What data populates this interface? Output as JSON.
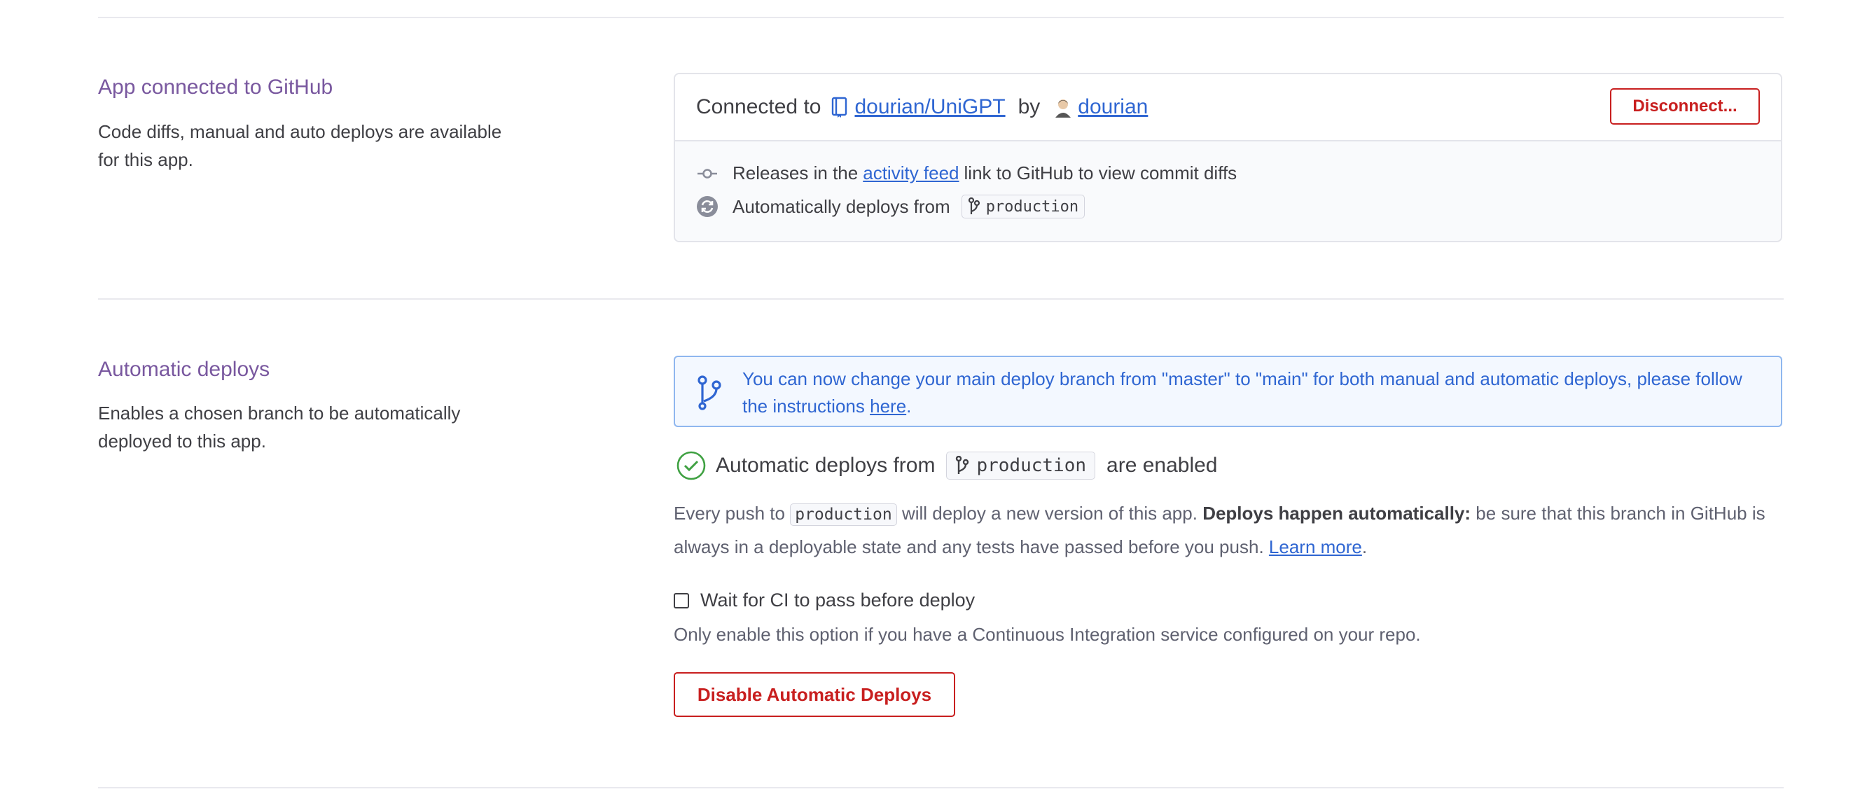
{
  "github_section": {
    "title": "App connected to GitHub",
    "description": "Code diffs, manual and auto deploys are available for this app.",
    "connected_prefix": "Connected to",
    "repo_link": "dourian/UniGPT",
    "by_label": "by",
    "user_link": "dourian",
    "disconnect_label": "Disconnect...",
    "releases_prefix": "Releases in the",
    "activity_feed_link": "activity feed",
    "releases_suffix": "link to GitHub to view commit diffs",
    "auto_deploys_prefix": "Automatically deploys from",
    "branch": "production"
  },
  "auto_deploys_section": {
    "title": "Automatic deploys",
    "description": "Enables a chosen branch to be automatically deployed to this app.",
    "banner_text": "You can now change your main deploy branch from \"master\" to \"main\" for both manual and automatic deploys, please follow the instructions",
    "banner_link": "here",
    "banner_end": ".",
    "enabled_prefix": "Automatic deploys from",
    "branch": "production",
    "enabled_suffix": "are enabled",
    "push_prefix": "Every push to",
    "push_branch": "production",
    "push_middle": "will deploy a new version of this app.",
    "push_bold": "Deploys happen automatically:",
    "push_rest": "be sure that this branch in GitHub is always in a deployable state and any tests have passed before you push.",
    "learn_more": "Learn more",
    "learn_more_end": ".",
    "ci_checkbox_label": "Wait for CI to pass before deploy",
    "ci_checked": false,
    "ci_hint": "Only enable this option if you have a Continuous Integration service configured on your repo.",
    "disable_button": "Disable Automatic Deploys"
  },
  "colors": {
    "title": "#79589f",
    "link": "#2f66d2",
    "danger": "#c81f1f",
    "success": "#3fa142"
  }
}
